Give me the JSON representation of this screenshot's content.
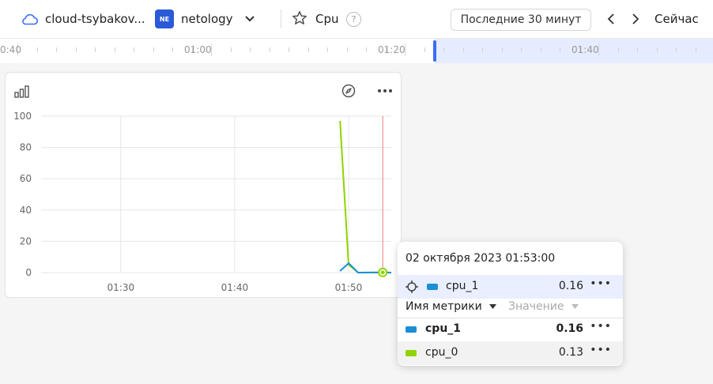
{
  "header": {
    "cloud_name": "cloud-tsybakov...",
    "folder_badge": "NE",
    "folder_name": "netology",
    "dashboard_title": "Cpu",
    "help_symbol": "?",
    "time_range": "Последние 30 минут",
    "now_label": "Сейчас"
  },
  "timeline": {
    "labels": [
      "0:40",
      "01:00",
      "01:20",
      "01:40"
    ]
  },
  "widget": {
    "icons": [
      "chart-type-icon",
      "compass-icon",
      "more-icon"
    ]
  },
  "chart_data": {
    "type": "line",
    "x_ticks": [
      "01:30",
      "01:40",
      "01:50"
    ],
    "y_ticks": [
      "100",
      "80",
      "60",
      "40",
      "20",
      "0"
    ],
    "ylim": [
      0,
      100
    ],
    "xlim": [
      "01:23",
      "01:53:45"
    ],
    "grid": true,
    "legend": "none",
    "series": [
      {
        "name": "cpu_0",
        "color": "#8fd400",
        "x": [
          "01:49:15",
          "01:50:00",
          "01:50:50",
          "01:53:00",
          "01:53:45"
        ],
        "y": [
          97,
          5,
          0,
          0.13,
          0
        ]
      },
      {
        "name": "cpu_1",
        "color": "#1b8fd6",
        "x": [
          "01:49:15",
          "01:50:00",
          "01:50:50",
          "01:53:00",
          "01:53:45"
        ],
        "y": [
          1,
          6,
          0,
          0.16,
          0
        ]
      }
    ],
    "cursor_x": "01:53:00",
    "cursor_color": "#f07a7a"
  },
  "tooltip": {
    "date": "02 октября 2023 01:53:00",
    "highlight": {
      "name": "cpu_1",
      "value": "0.16",
      "color": "#1b8fd6"
    },
    "col_name": "Имя метрики",
    "col_value": "Значение",
    "rows": [
      {
        "name": "cpu_1",
        "value": "0.16",
        "color": "#1b8fd6"
      },
      {
        "name": "cpu_0",
        "value": "0.13",
        "color": "#8fd400"
      }
    ],
    "more_symbol": "•••"
  }
}
